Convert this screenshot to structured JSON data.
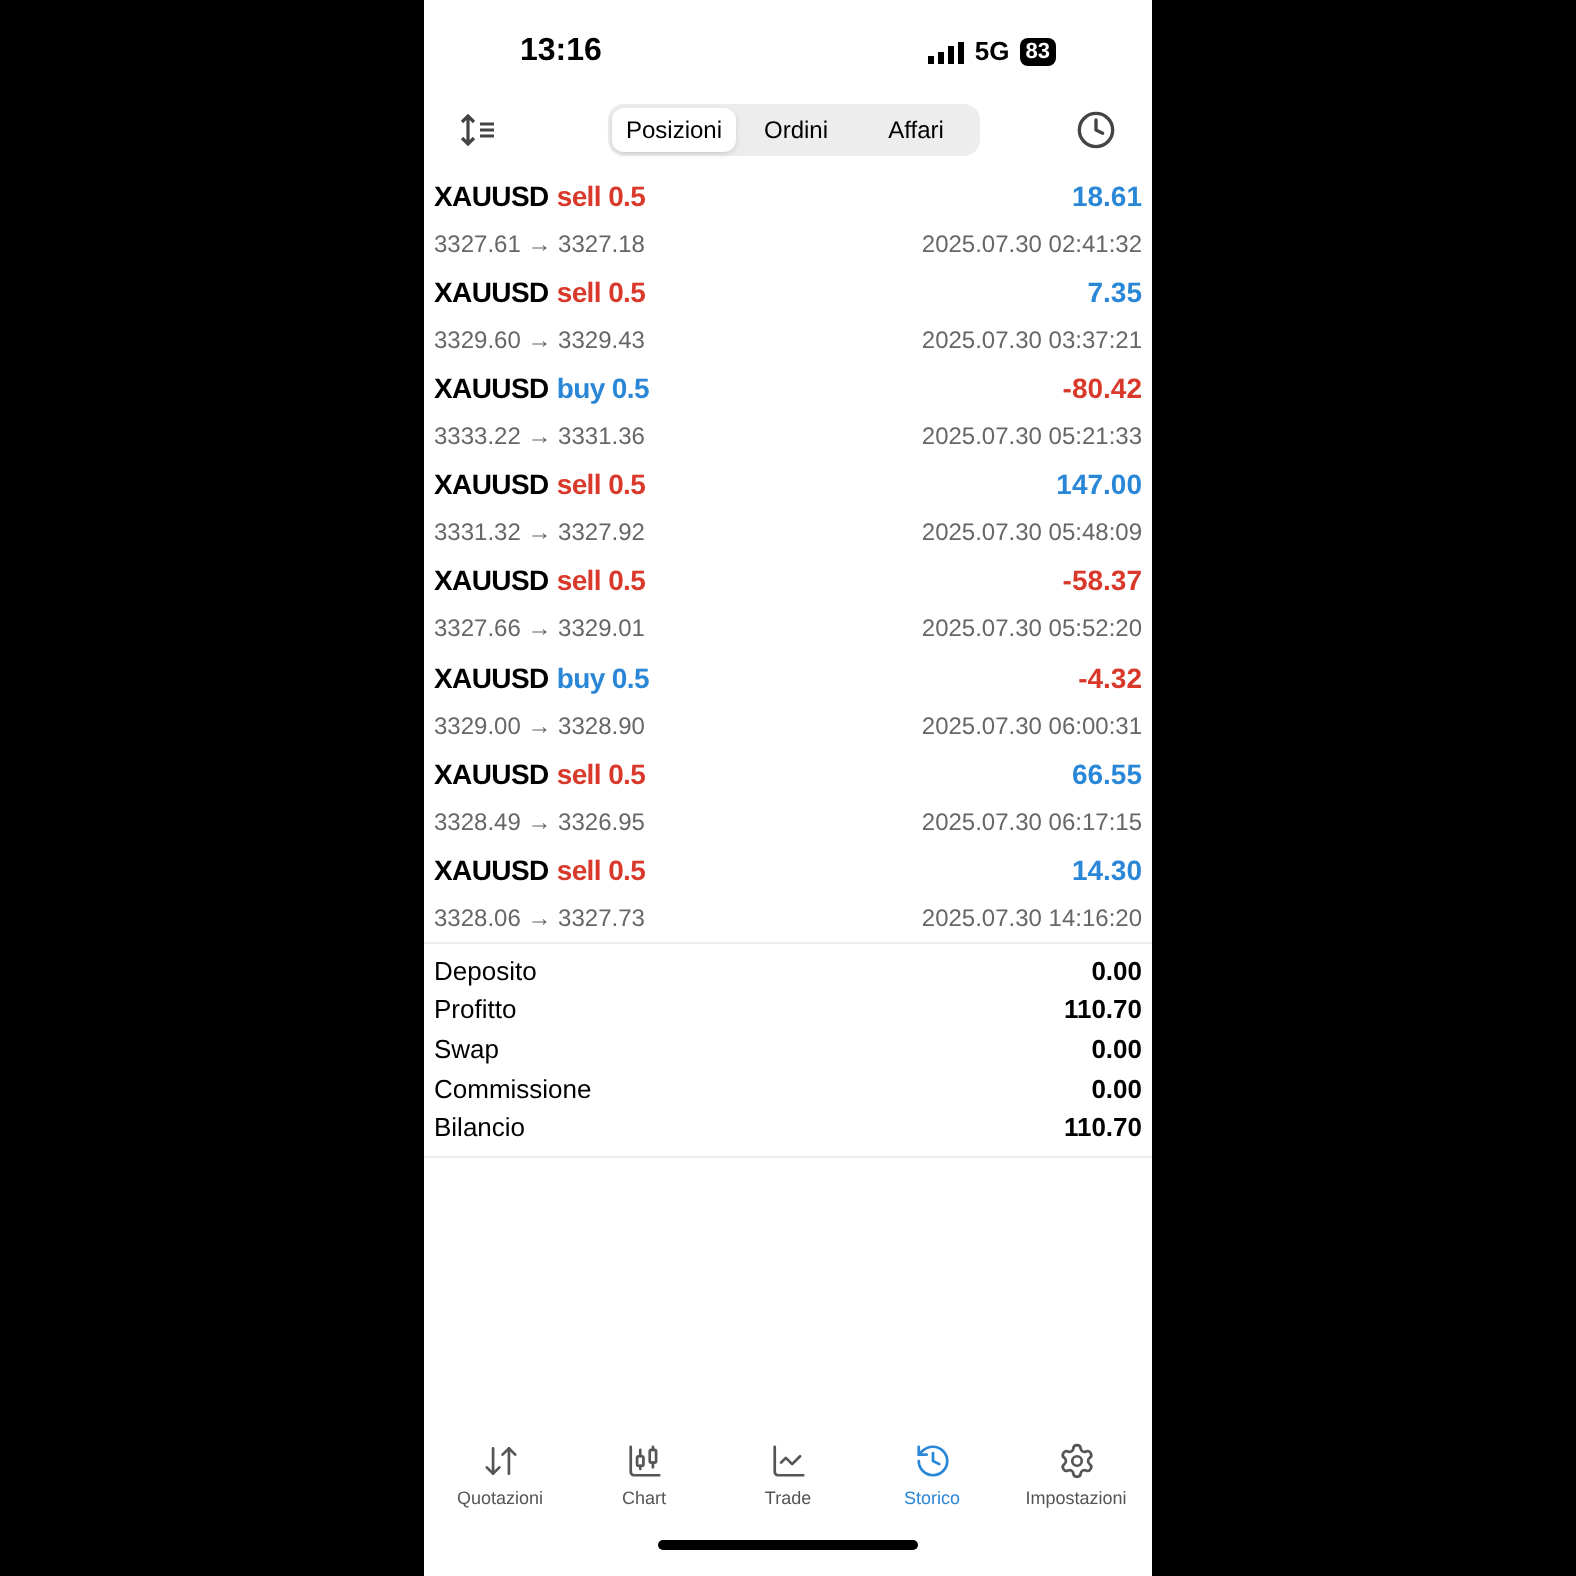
{
  "status_bar": {
    "time": "13:16",
    "network": "5G",
    "battery": "83"
  },
  "tabs": [
    {
      "label": "Posizioni",
      "selected": true
    },
    {
      "label": "Ordini",
      "selected": false
    },
    {
      "label": "Affari",
      "selected": false
    }
  ],
  "deals": [
    {
      "symbol": "XAUUSD",
      "kind": "sell",
      "volume": "sell 0.5",
      "profit": "18.61",
      "positive": true,
      "prices": "3327.61 → 3327.18",
      "time": "2025.07.30 02:41:32"
    },
    {
      "symbol": "XAUUSD",
      "kind": "sell",
      "volume": "sell 0.5",
      "profit": "7.35",
      "positive": true,
      "prices": "3329.60 → 3329.43",
      "time": "2025.07.30 03:37:21"
    },
    {
      "symbol": "XAUUSD",
      "kind": "buy",
      "volume": "buy 0.5",
      "profit": "-80.42",
      "positive": false,
      "prices": "3333.22 → 3331.36",
      "time": "2025.07.30 05:21:33"
    },
    {
      "symbol": "XAUUSD",
      "kind": "sell",
      "volume": "sell 0.5",
      "profit": "147.00",
      "positive": true,
      "prices": "3331.32 → 3327.92",
      "time": "2025.07.30 05:48:09"
    },
    {
      "symbol": "XAUUSD",
      "kind": "sell",
      "volume": "sell 0.5",
      "profit": "-58.37",
      "positive": false,
      "prices": "3327.66 → 3329.01",
      "time": "2025.07.30 05:52:20"
    },
    {
      "symbol": "XAUUSD",
      "kind": "buy",
      "volume": "buy 0.5",
      "profit": "-4.32",
      "positive": false,
      "prices": "3329.00 → 3328.90",
      "time": "2025.07.30 06:00:31"
    },
    {
      "symbol": "XAUUSD",
      "kind": "sell",
      "volume": "sell 0.5",
      "profit": "66.55",
      "positive": true,
      "prices": "3328.49 → 3326.95",
      "time": "2025.07.30 06:17:15"
    },
    {
      "symbol": "XAUUSD",
      "kind": "sell",
      "volume": "sell 0.5",
      "profit": "14.30",
      "positive": true,
      "prices": "3328.06 → 3327.73",
      "time": "2025.07.30 14:16:20"
    }
  ],
  "summary": [
    {
      "label": "Deposito",
      "value": "0.00"
    },
    {
      "label": "Profitto",
      "value": "110.70"
    },
    {
      "label": "Swap",
      "value": "0.00"
    },
    {
      "label": "Commissione",
      "value": "0.00"
    },
    {
      "label": "Bilancio",
      "value": "110.70"
    }
  ],
  "nav": [
    {
      "kind": "quotes",
      "label": "Quotazioni",
      "selected": false
    },
    {
      "kind": "chart",
      "label": "Chart",
      "selected": false
    },
    {
      "kind": "trade",
      "label": "Trade",
      "selected": false
    },
    {
      "kind": "history",
      "label": "Storico",
      "selected": true
    },
    {
      "kind": "settings",
      "label": "Impostazioni",
      "selected": false
    }
  ]
}
